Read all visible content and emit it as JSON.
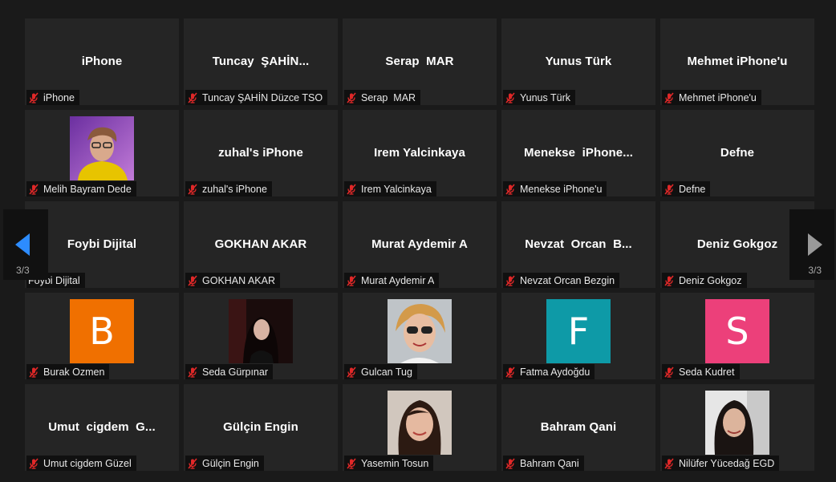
{
  "pagination": {
    "prev_indicator": "3/3",
    "next_indicator": "3/3"
  },
  "colors": {
    "background": "#1a1a1a",
    "tile": "#252525",
    "mute_icon": "#e02828",
    "prev_arrow": "#2d8cff",
    "next_arrow": "#9a9a9a"
  },
  "participants": [
    {
      "title": "iPhone",
      "name": "iPhone",
      "avatar": "none",
      "muted": true
    },
    {
      "title": "Tuncay  ŞAHİN...",
      "name": "Tuncay ŞAHİN Düzce TSO",
      "avatar": "none",
      "muted": true
    },
    {
      "title": "Serap  MAR",
      "name": "Serap  MAR",
      "avatar": "none",
      "muted": true
    },
    {
      "title": "Yunus Türk",
      "name": "Yunus Türk",
      "avatar": "none",
      "muted": true
    },
    {
      "title": "Mehmet iPhone'u",
      "name": "Mehmet iPhone'u",
      "avatar": "none",
      "muted": true
    },
    {
      "title": "",
      "name": "Melih Bayram Dede",
      "avatar": "photo",
      "photo_icon": "man-with-glasses-photo",
      "muted": true
    },
    {
      "title": "zuhal's iPhone",
      "name": "zuhal's iPhone",
      "avatar": "none",
      "muted": true
    },
    {
      "title": "Irem Yalcinkaya",
      "name": "Irem Yalcinkaya",
      "avatar": "none",
      "muted": true
    },
    {
      "title": "Menekse  iPhone...",
      "name": "Menekse iPhone'u",
      "avatar": "none",
      "muted": true
    },
    {
      "title": "Defne",
      "name": "Defne",
      "avatar": "none",
      "muted": true
    },
    {
      "title": "Foybi Dijital",
      "name": "Foybi Dijital",
      "avatar": "none",
      "muted": false
    },
    {
      "title": "GOKHAN AKAR",
      "name": "GOKHAN AKAR",
      "avatar": "none",
      "muted": true
    },
    {
      "title": "Murat Aydemir A",
      "name": "Murat Aydemir A",
      "avatar": "none",
      "muted": true
    },
    {
      "title": "Nevzat  Orcan  B...",
      "name": "Nevzat Orcan Bezgin",
      "avatar": "none",
      "muted": true
    },
    {
      "title": "Deniz Gokgoz",
      "name": "Deniz Gokgoz",
      "avatar": "none",
      "muted": true
    },
    {
      "title": "",
      "name": "Burak Ozmen",
      "avatar": "letter",
      "letter": "B",
      "color": "#f07000",
      "muted": true
    },
    {
      "title": "",
      "name": "Seda Gürpınar",
      "avatar": "photo",
      "photo_icon": "woman-dark-hair-photo",
      "muted": true
    },
    {
      "title": "",
      "name": "Gulcan Tug",
      "avatar": "photo",
      "photo_icon": "woman-sunglasses-photo",
      "muted": true
    },
    {
      "title": "",
      "name": "Fatma Aydoğdu",
      "avatar": "letter",
      "letter": "F",
      "color": "#0e9aa7",
      "muted": true
    },
    {
      "title": "",
      "name": "Seda Kudret",
      "avatar": "letter",
      "letter": "S",
      "color": "#ec407a",
      "muted": true
    },
    {
      "title": "Umut  cigdem  G...",
      "name": "Umut cigdem Güzel",
      "avatar": "none",
      "muted": true
    },
    {
      "title": "Gülçin Engin",
      "name": "Gülçin Engin",
      "avatar": "none",
      "muted": true
    },
    {
      "title": "",
      "name": "Yasemin Tosun",
      "avatar": "photo",
      "photo_icon": "woman-smiling-photo",
      "muted": true
    },
    {
      "title": "Bahram Qani",
      "name": "Bahram Qani",
      "avatar": "none",
      "muted": true
    },
    {
      "title": "",
      "name": "Nilüfer Yücedağ EGD",
      "avatar": "photo",
      "photo_icon": "woman-long-hair-photo",
      "muted": true
    }
  ]
}
